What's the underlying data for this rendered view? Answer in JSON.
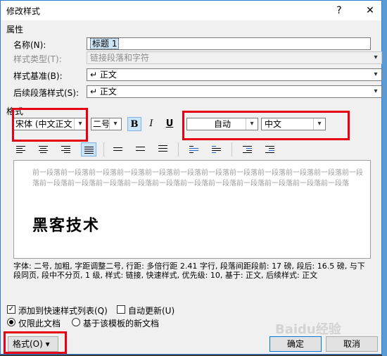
{
  "window": {
    "title": "修改样式",
    "help": "?",
    "close": "✕"
  },
  "properties": {
    "section": "属性",
    "name_label": "名称(N):",
    "name_value": "标题 1",
    "type_label": "样式类型(T):",
    "type_value": "链接段落和字符",
    "based_label": "样式基准(B):",
    "based_value": "正文",
    "next_label": "后续段落样式(S):",
    "next_value": "正文",
    "para_mark": "↵"
  },
  "format": {
    "section": "格式",
    "font": "宋体 (中文正文",
    "size": "二号",
    "bold": "B",
    "italic": "I",
    "underline": "U",
    "color": "自动",
    "lang": "中文"
  },
  "preview": {
    "prev_text": "前一段落前一段落前一段落前一段落前一段落前一段落前一段落前一段落前一段落前一段落前一段落前一段落前一段落前一段落前一段落前一段落前一段落前一段落前一段落前一段落前一段落前一段落前一段落",
    "main_text": "黑客技术"
  },
  "description": "字体: 二号, 加粗, 字距调整二号, 行距: 多倍行距 2.41 字行, 段落间距段前: 17 磅, 段后: 16.5 磅, 与下段同页, 段中不分页, 1 级, 样式: 链接, 快速样式, 优先级: 10, 基于: 正文, 后续样式: 正文",
  "options": {
    "add_quick": "添加到快速样式列表(Q)",
    "auto_update": "自动更新(U)",
    "only_doc": "仅限此文档",
    "new_docs": "基于该模板的新文档"
  },
  "buttons": {
    "format": "格式(O)",
    "ok": "确定",
    "cancel": "取消"
  },
  "watermark": "Baidu经验"
}
